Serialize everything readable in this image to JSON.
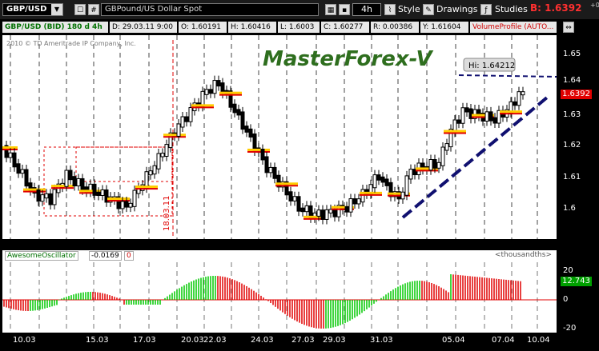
{
  "toolbar": {
    "symbol": "GBP/USD",
    "description": "GBPound/US Dollar Spot",
    "period": "4h",
    "style_label": "Style",
    "drawings_label": "Drawings",
    "studies_label": "Studies",
    "bid": "B: 1.6392",
    "bid_sub": "+0"
  },
  "info": {
    "series": "GBP/USD (BID) 180 d 4h",
    "date": "D: 29.03.11 9:00",
    "open": "O: 1.60191",
    "high": "H: 1.60416",
    "low": "L: 1.6003",
    "close": "C: 1.60277",
    "change": "R: 0.00386",
    "y": "Y: 1.61604",
    "study": "VolumeProfile (AUTO..."
  },
  "chart": {
    "copyright": "2010 © TD Ameritrade IP Company, Inc.",
    "watermark": "MasterForex-V",
    "hi_label": "Hi: 1.64212",
    "date_marker": "18.03.11",
    "price_tag": "1.6392",
    "y_ticks": [
      "1.65",
      "1.64",
      "1.63",
      "1.62",
      "1.61",
      "1.6"
    ]
  },
  "oscillator": {
    "name": "AwesomeOscillator",
    "value": "-0.0169",
    "flag": "0",
    "units": "<thousandths>",
    "y_ticks": [
      "20",
      "0",
      "-20"
    ],
    "current": "12.743"
  },
  "x_axis": [
    "10.03",
    "15.03",
    "17.03",
    "20.03",
    "22.03",
    "24.03",
    "27.03",
    "29.03",
    "31.03",
    "05.04",
    "07.04",
    "10.04"
  ],
  "colors": {
    "up": "#00c800",
    "down": "#e00000",
    "background": "#ffffff",
    "frame": "#000000",
    "trend": "#101070"
  }
}
